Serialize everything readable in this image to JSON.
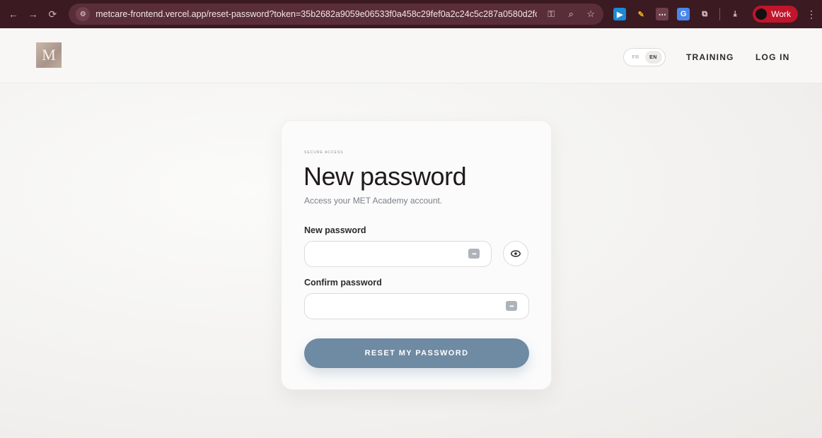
{
  "browser": {
    "url": "metcare-frontend.vercel.app/reset-password?token=35b2682a9059e06533f0a458c29fef0a2c24c5c287a0580d2fcfce8...",
    "profile_label": "Work"
  },
  "header": {
    "logo_letter": "M",
    "languages": [
      "FR",
      "EN"
    ],
    "active_language": "EN",
    "nav": {
      "training": "TRAINING",
      "login": "LOG IN"
    }
  },
  "card": {
    "eyebrow": "SECURE ACCESS",
    "title": "New password",
    "subtitle": "Access your MET Academy account.",
    "new_password_label": "New password",
    "confirm_password_label": "Confirm password",
    "submit_label": "RESET MY PASSWORD"
  },
  "colors": {
    "chrome_bg": "#3b1a22",
    "button_bg": "#6f8aa3",
    "profile_bg": "#c0152b"
  }
}
